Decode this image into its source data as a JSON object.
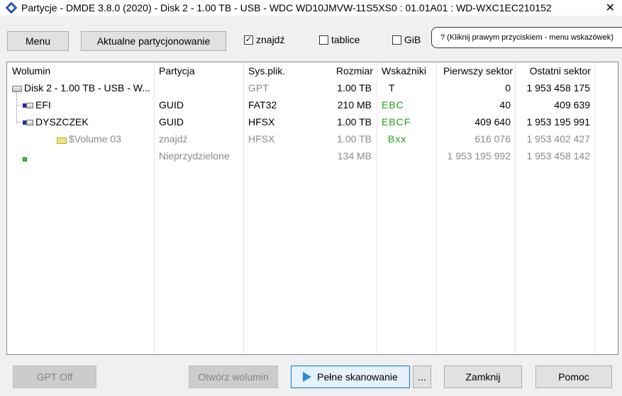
{
  "window": {
    "title": "Partycje - DMDE 3.8.0 (2020) - Disk 2 - 1.00 TB - USB - WDC WD10JMVW-11S5XS0 : 01.01A01 : WD-WXC1EC210152",
    "close_glyph": "✕"
  },
  "toolbar": {
    "menu_label": "Menu",
    "current_partitioning_label": "Aktualne partycjonowanie",
    "find_label": "znajdź",
    "find_checked": true,
    "tables_label": "tablice",
    "tables_checked": false,
    "gib_label": "GiB",
    "gib_checked": false,
    "hint_text": "? (Kliknij prawym przyciskiem - menu wskazówek)"
  },
  "table": {
    "columns": [
      "Wolumin",
      "Partycja",
      "Sys.plik.",
      "Rozmiar",
      "Wskaźniki",
      "Pierwszy sektor",
      "Ostatni sektor"
    ],
    "rows": [
      {
        "volume": "Disk 2 - 1.00 TB - USB - W...",
        "partition": "",
        "fs": "GPT",
        "size": "1.00 TB",
        "flags": "T",
        "first": "0",
        "last": "1 953 458 175",
        "icon": "disk-icon"
      },
      {
        "volume": "EFI",
        "partition": "GUID",
        "fs": "FAT32",
        "size": "210 MB",
        "flags": "EBC",
        "first": "40",
        "last": "409 639",
        "icon": "volume-icon"
      },
      {
        "volume": "DYSZCZEK",
        "partition": "GUID",
        "fs": "HFSX",
        "size": "1.00 TB",
        "flags": "EBCF",
        "first": "409 640",
        "last": "1 953 195 991",
        "icon": "volume-icon"
      },
      {
        "volume": "$Volume 03",
        "partition": "znajdź",
        "fs": "HFSX",
        "size": "1.00 TB",
        "flags": "Bxx",
        "first": "616 076",
        "last": "1 953 402 427",
        "icon": "found-volume-icon"
      },
      {
        "volume": "",
        "partition": "Nieprzydzielone",
        "fs": "",
        "size": "134 MB",
        "flags": "",
        "first": "1 953 195 992",
        "last": "1 953 458 142",
        "icon": "unallocated-icon"
      }
    ]
  },
  "buttons": {
    "gpt_off": "GPT Off",
    "open_volume": "Otwórz wolumin",
    "full_scan": "Pełne skanowanie",
    "more": "...",
    "close": "Zamknij",
    "help": "Pomoc"
  },
  "colors": {
    "flags_green": "#22a022",
    "focus_blue": "#0078d7",
    "play_blue": "#2a8ad8"
  }
}
